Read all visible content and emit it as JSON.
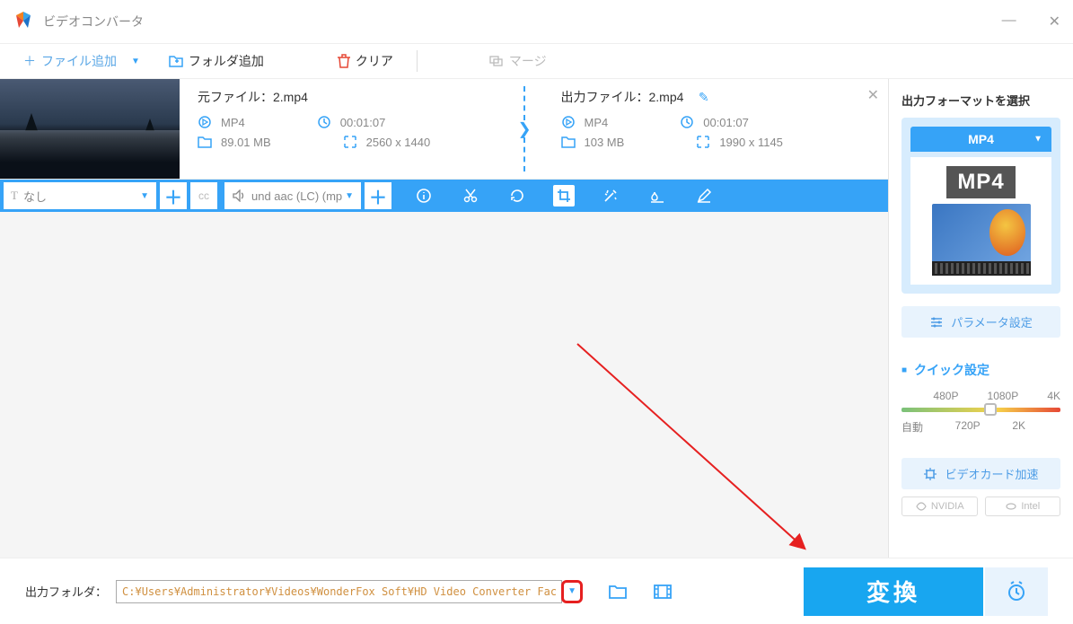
{
  "app": {
    "title": "ビデオコンバータ"
  },
  "toolbar": {
    "add_file": "ファイル追加",
    "add_folder": "フォルダ追加",
    "clear": "クリア",
    "merge": "マージ"
  },
  "file": {
    "source_label": "元ファイル：",
    "source_name": "2.mp4",
    "output_label": "出力ファイル：",
    "output_name": "2.mp4",
    "src": {
      "format": "MP4",
      "duration": "00:01:07",
      "size": "89.01 MB",
      "resolution": "2560 x 1440"
    },
    "out": {
      "format": "MP4",
      "duration": "00:01:07",
      "size": "103 MB",
      "resolution": "1990 x 1145"
    }
  },
  "controls": {
    "subtitle_option": "なし",
    "subtitle_prefix": "T",
    "audio_option": "und aac (LC) (mp"
  },
  "right": {
    "title": "出力フォーマットを選択",
    "format": "MP4",
    "format_badge": "MP4",
    "param_button": "パラメータ設定",
    "quick_title": "クイック設定",
    "quality_labels_top": [
      "480P",
      "1080P",
      "4K"
    ],
    "quality_labels_bottom": [
      "自動",
      "720P",
      "2K"
    ],
    "vcard_button": "ビデオカード加速",
    "vendors": [
      "NVIDIA",
      "Intel"
    ]
  },
  "bottom": {
    "out_folder_label": "出力フォルダ：",
    "out_folder_path": "C:¥Users¥Administrator¥Videos¥WonderFox Soft¥HD Video Converter Factory¥OutputVideo¥",
    "convert_label": "変換"
  }
}
